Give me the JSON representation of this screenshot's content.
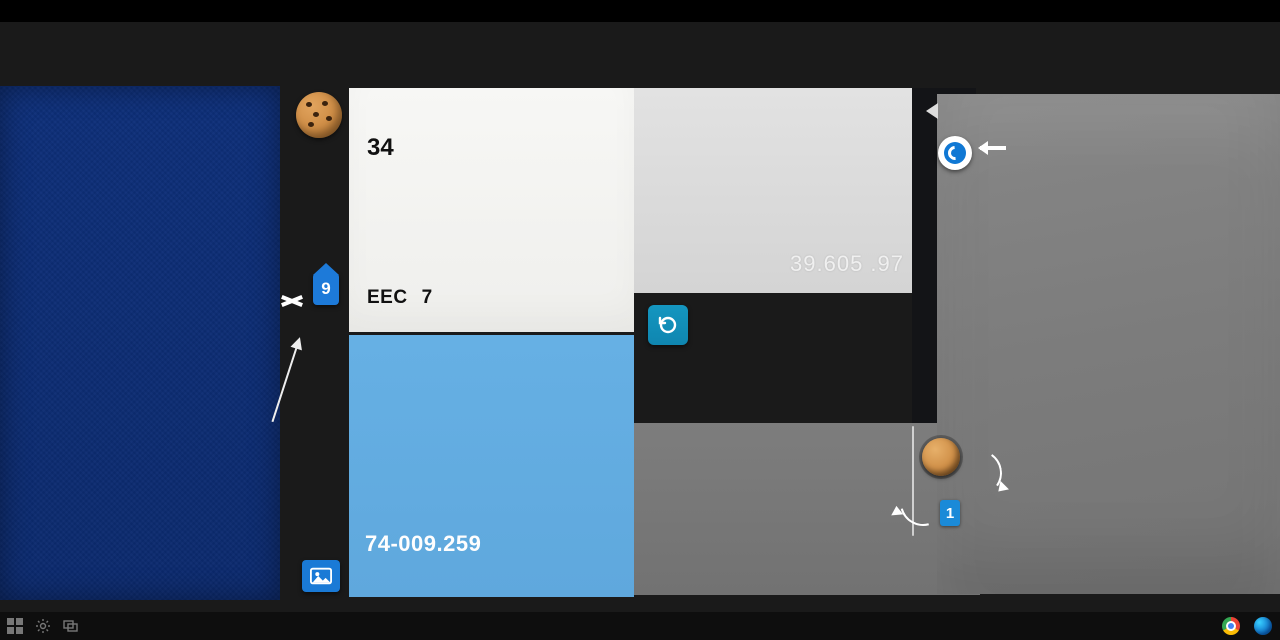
{
  "tiles": {
    "white": {
      "number": "34",
      "code_label": "EEC",
      "code_value": "7"
    },
    "faint": {
      "value": "39.605 .97"
    },
    "blue": {
      "value": "74-009.259"
    }
  },
  "pin": {
    "value": "9"
  },
  "badge_one": {
    "value": "1"
  },
  "taskbar": {
    "start": "start",
    "settings": "settings",
    "task_view": "task-view",
    "chrome": "chrome",
    "edge": "edge"
  }
}
